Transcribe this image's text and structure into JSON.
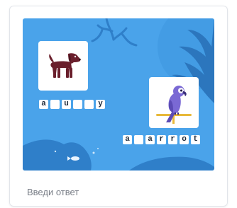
{
  "task_card": {
    "answer_label": "Введи ответ",
    "scene_color": "#4aa3ea",
    "words": [
      {
        "picture": "dog-icon",
        "letters": [
          "a",
          "",
          "u",
          "",
          "",
          "y"
        ]
      },
      {
        "picture": "parrot-icon",
        "letters": [
          "a",
          "",
          "a",
          "r",
          "r",
          "o",
          "t"
        ]
      }
    ]
  }
}
